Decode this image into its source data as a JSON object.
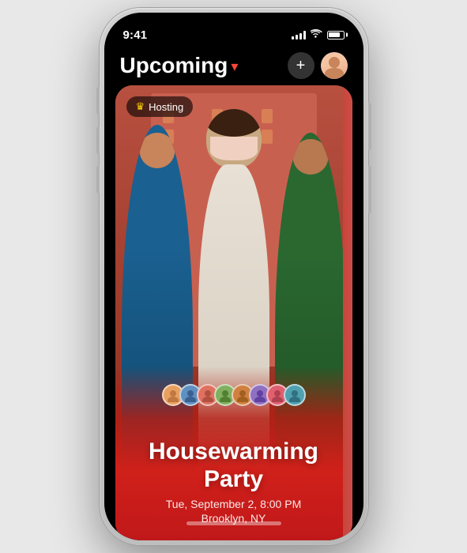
{
  "phone": {
    "status_bar": {
      "time": "9:41",
      "signal_label": "signal",
      "wifi_label": "wifi",
      "battery_label": "battery"
    },
    "nav": {
      "title": "Upcoming",
      "chevron": "▾",
      "add_button_label": "+",
      "avatar_label": "profile"
    },
    "event_card": {
      "hosting_badge": "Hosting",
      "crown_label": "crown",
      "event_title_line1": "Housewarming",
      "event_title_line2": "Party",
      "event_date": "Tue, September 2, 8:00 PM",
      "event_location": "Brooklyn, NY",
      "attendees": [
        {
          "color": "#e8a060",
          "label": "attendee1"
        },
        {
          "color": "#6090c0",
          "label": "attendee2"
        },
        {
          "color": "#c06050",
          "label": "attendee3"
        },
        {
          "color": "#80b060",
          "label": "attendee4"
        },
        {
          "color": "#d08040",
          "label": "attendee5"
        },
        {
          "color": "#9070c0",
          "label": "attendee6"
        },
        {
          "color": "#e06070",
          "label": "attendee7"
        },
        {
          "color": "#50a0b0",
          "label": "attendee8"
        }
      ]
    }
  }
}
